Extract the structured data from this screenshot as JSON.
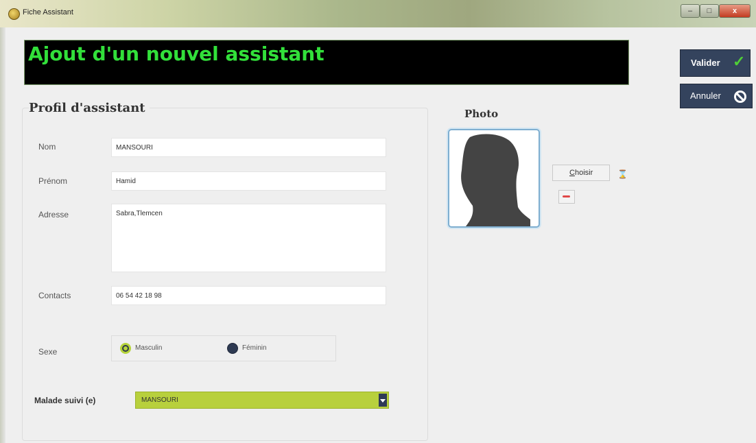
{
  "window": {
    "title": "Fiche Assistant",
    "controls": [
      "minimize-icon",
      "maximize-icon",
      "close-icon"
    ]
  },
  "header": {
    "banner_text": "Ajout d'un nouvel assistant"
  },
  "actions": {
    "valider_label": "Valider",
    "valider_icon": "check-icon",
    "annuler_label": "Annuler",
    "annuler_icon": "cancel-icon"
  },
  "profile": {
    "title": "Profil d'assistant",
    "fields": {
      "nom": {
        "label": "Nom",
        "value": "MANSOURI"
      },
      "prenom": {
        "label": "Prénom",
        "value": "Hamid"
      },
      "adresse": {
        "label": "Adresse",
        "value": "Sabra,Tlemcen"
      },
      "contacts": {
        "label": "Contacts",
        "value": "06 54  42 18 98"
      },
      "sexe": {
        "label": "Sexe",
        "options": [
          "Masculin",
          "Féminin"
        ],
        "selected": "Masculin"
      }
    },
    "malade": {
      "label": "Malade suivi (e)",
      "value": "MANSOURI"
    }
  },
  "photo": {
    "label": "Photo",
    "choisir_label": "Choisir",
    "silhouette": "avatar-placeholder"
  },
  "colors": {
    "banner_bg": "#000000",
    "banner_text": "#32e03a",
    "button_bg": "#34435d",
    "select_bg": "#b8d03d"
  }
}
